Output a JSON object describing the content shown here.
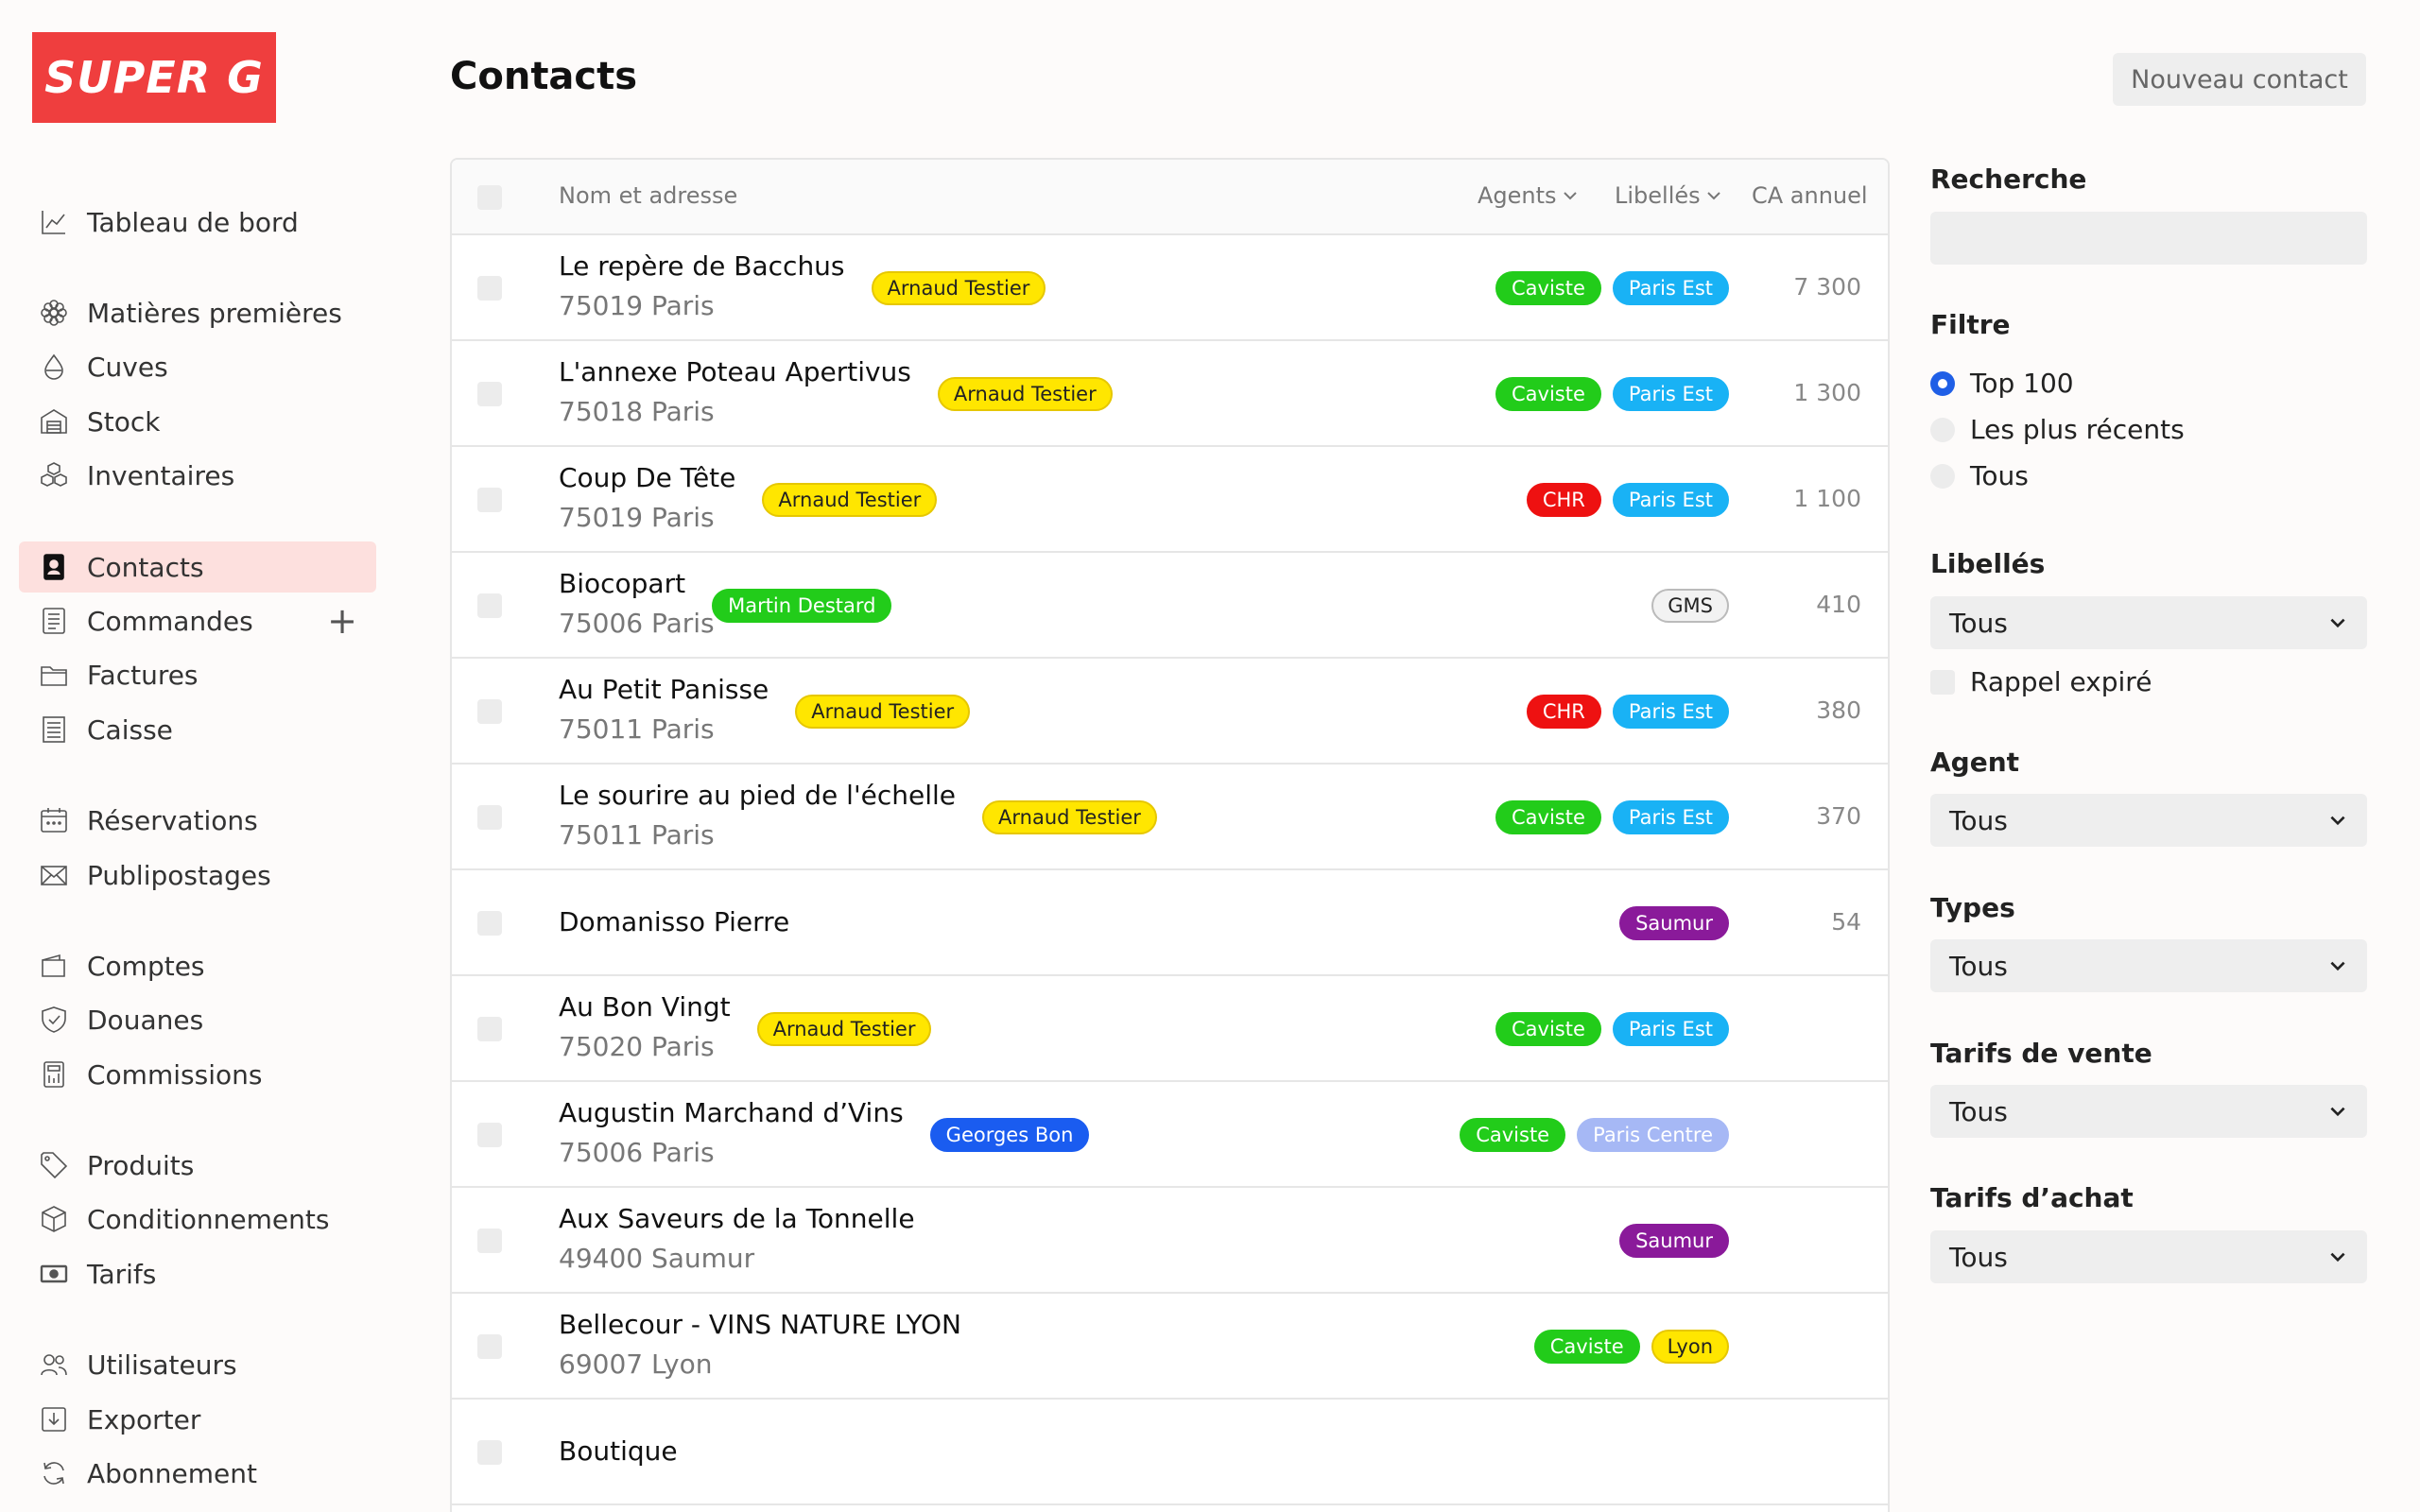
{
  "logo": {
    "text": "SUPER G"
  },
  "sidebar": {
    "items": [
      {
        "label": "Tableau de bord",
        "icon": "chart-line-icon"
      },
      {
        "label": "Matières premières",
        "icon": "flower-icon"
      },
      {
        "label": "Cuves",
        "icon": "drop-icon"
      },
      {
        "label": "Stock",
        "icon": "warehouse-icon"
      },
      {
        "label": "Inventaires",
        "icon": "boxes-icon"
      },
      {
        "label": "Contacts",
        "icon": "contact-card-icon",
        "active": true
      },
      {
        "label": "Commandes",
        "icon": "order-list-icon",
        "plus": "+"
      },
      {
        "label": "Factures",
        "icon": "folder-icon"
      },
      {
        "label": "Caisse",
        "icon": "receipt-icon"
      },
      {
        "label": "Réservations",
        "icon": "calendar-icon"
      },
      {
        "label": "Publipostages",
        "icon": "envelope-icon"
      },
      {
        "label": "Comptes",
        "icon": "wallet-icon"
      },
      {
        "label": "Douanes",
        "icon": "shield-check-icon"
      },
      {
        "label": "Commissions",
        "icon": "calculator-icon"
      },
      {
        "label": "Produits",
        "icon": "tag-icon"
      },
      {
        "label": "Conditionnements",
        "icon": "box-icon"
      },
      {
        "label": "Tarifs",
        "icon": "banknote-icon"
      },
      {
        "label": "Utilisateurs",
        "icon": "users-icon"
      },
      {
        "label": "Exporter",
        "icon": "download-icon"
      },
      {
        "label": "Abonnement",
        "icon": "refresh-icon"
      }
    ]
  },
  "header": {
    "title": "Contacts",
    "new_contact_label": "Nouveau contact"
  },
  "table": {
    "columns": {
      "name": "Nom et adresse",
      "agents": "Agents",
      "labels": "Libellés",
      "ca": "CA annuel"
    },
    "rows": [
      {
        "name": "Le repère de Bacchus",
        "address": "75019 Paris",
        "agent": "Arnaud Testier",
        "tags": [
          "Caviste",
          "Paris Est"
        ],
        "ca": "7 300"
      },
      {
        "name": "L'annexe Poteau Apertivus",
        "address": "75018 Paris",
        "agent": "Arnaud Testier",
        "tags": [
          "Caviste",
          "Paris Est"
        ],
        "ca": "1 300"
      },
      {
        "name": "Coup De Tête",
        "address": "75019 Paris",
        "agent": "Arnaud Testier",
        "tags": [
          "CHR",
          "Paris Est"
        ],
        "ca": "1 100"
      },
      {
        "name": "Biocopart",
        "address": "75006 Paris",
        "agent": "Martin Destard",
        "tags": [
          "GMS"
        ],
        "ca": "410"
      },
      {
        "name": "Au Petit Panisse",
        "address": "75011 Paris",
        "agent": "Arnaud Testier",
        "tags": [
          "CHR",
          "Paris Est"
        ],
        "ca": "380"
      },
      {
        "name": "Le sourire au pied de l'échelle",
        "address": "75011 Paris",
        "agent": "Arnaud Testier",
        "tags": [
          "Caviste",
          "Paris Est"
        ],
        "ca": "370"
      },
      {
        "name": "Domanisso Pierre",
        "address": "",
        "agent": "",
        "tags": [
          "Saumur"
        ],
        "ca": "54"
      },
      {
        "name": "Au Bon Vingt",
        "address": "75020 Paris",
        "agent": "Arnaud Testier",
        "tags": [
          "Caviste",
          "Paris Est"
        ],
        "ca": ""
      },
      {
        "name": "Augustin Marchand d’Vins",
        "address": "75006 Paris",
        "agent": "Georges Bon",
        "tags": [
          "Caviste",
          "Paris Centre"
        ],
        "ca": ""
      },
      {
        "name": "Aux Saveurs de la Tonnelle",
        "address": "49400 Saumur",
        "agent": "",
        "tags": [
          "Saumur"
        ],
        "ca": ""
      },
      {
        "name": "Bellecour - VINS NATURE LYON",
        "address": "69007 Lyon",
        "agent": "",
        "tags": [
          "Caviste",
          "Lyon"
        ],
        "ca": ""
      },
      {
        "name": "Boutique",
        "address": "",
        "agent": "",
        "tags": [],
        "ca": ""
      }
    ]
  },
  "badge_colors": {
    "Arnaud Testier": {
      "bg": "#ffe600",
      "fg": "#222",
      "border": "#e6c700"
    },
    "Martin Destard": {
      "bg": "#22cc1a",
      "fg": "#fff",
      "border": "#22cc1a"
    },
    "Georges Bon": {
      "bg": "#1a5cf0",
      "fg": "#fff",
      "border": "#1a5cf0"
    },
    "Caviste": {
      "bg": "#22cc1a",
      "fg": "#fff",
      "border": "#22cc1a"
    },
    "Paris Est": {
      "bg": "#19b2f5",
      "fg": "#fff",
      "border": "#19b2f5"
    },
    "CHR": {
      "bg": "#ee1111",
      "fg": "#fff",
      "border": "#ee1111"
    },
    "GMS": {
      "bg": "#f2f2f2",
      "fg": "#222",
      "border": "#bbbbbb"
    },
    "Saumur": {
      "bg": "#8a1a9a",
      "fg": "#fff",
      "border": "#8a1a9a"
    },
    "Paris Centre": {
      "bg": "#a6b8f5",
      "fg": "#fff",
      "border": "#a6b8f5"
    },
    "Lyon": {
      "bg": "#ffe600",
      "fg": "#222",
      "border": "#e6c700"
    }
  },
  "filters": {
    "search_label": "Recherche",
    "search_placeholder": "",
    "filter_label": "Filtre",
    "filter_options": [
      {
        "label": "Top 100",
        "selected": true
      },
      {
        "label": "Les plus récents",
        "selected": false
      },
      {
        "label": "Tous",
        "selected": false
      }
    ],
    "labels_label": "Libellés",
    "labels_value": "Tous",
    "reminder_label": "Rappel expiré",
    "agent_label": "Agent",
    "agent_value": "Tous",
    "types_label": "Types",
    "types_value": "Tous",
    "sale_prices_label": "Tarifs de vente",
    "sale_prices_value": "Tous",
    "purchase_prices_label": "Tarifs d’achat",
    "purchase_prices_value": "Tous"
  }
}
